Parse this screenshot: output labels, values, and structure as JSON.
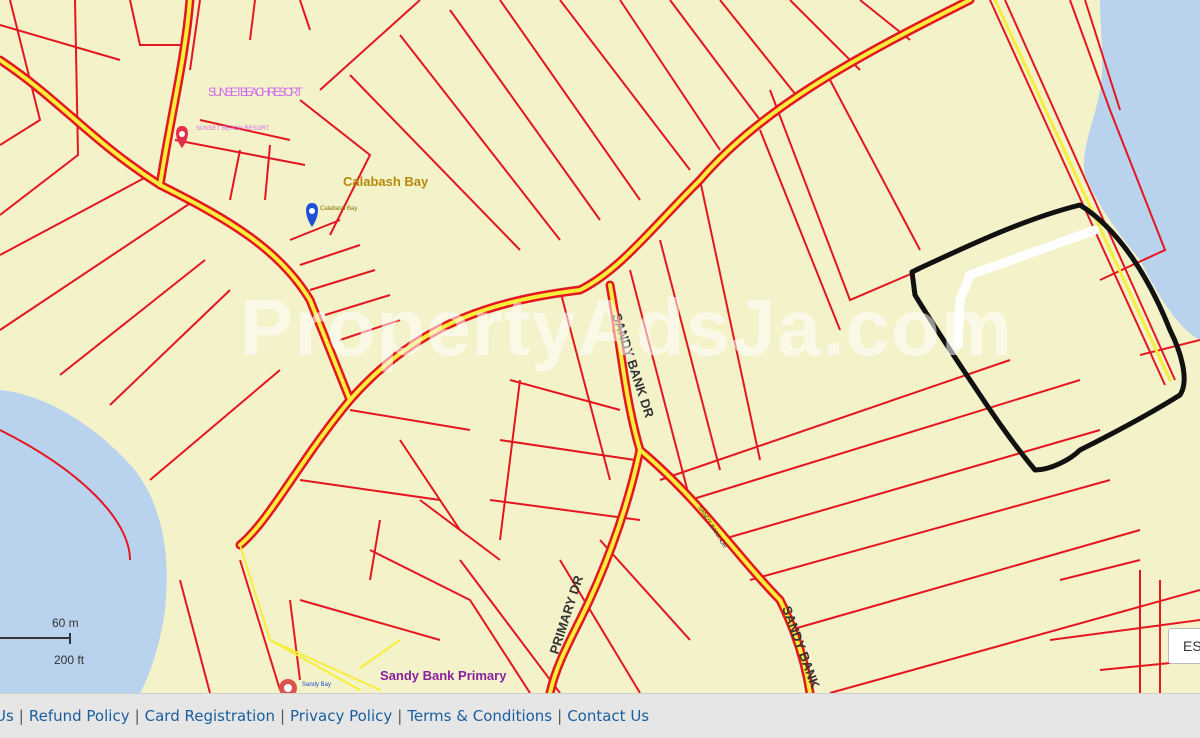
{
  "map": {
    "labels": {
      "resort": "SUNSET BEACH RESORT",
      "resort_small": "SUNSET BEACH RESORT",
      "calabash": "Calabash Bay",
      "calabash_small": "Calabash Bay",
      "school": "Sandy Bank Primary",
      "school_small": "Sandy Bay",
      "road_sandy_bank": "SANDY BANK DR",
      "road_sandy_bank_2": "SANDY BANK",
      "road_primary": "PRIMARY DR",
      "road_minor": "SANDY BANK DR"
    },
    "scale": {
      "metric": "60 m",
      "imperial": "200 ft"
    },
    "search_placeholder": "EST",
    "watermark": "PropertyAdsJa.com",
    "colors": {
      "land": "#f3f2c9",
      "water": "#b9d3ee",
      "parcel": "#e4161f",
      "road": "#f6ee3a",
      "annotation": "#111111"
    }
  },
  "footer": {
    "links": [
      "Us",
      "Refund Policy",
      "Card Registration",
      "Privacy Policy",
      "Terms & Conditions",
      "Contact Us"
    ]
  }
}
